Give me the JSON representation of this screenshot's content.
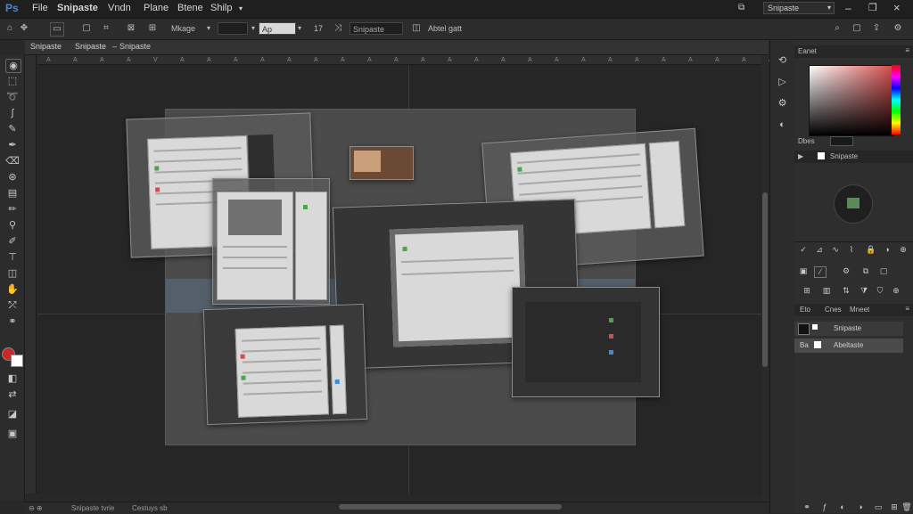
{
  "menu": {
    "logo": "Ps",
    "items": [
      "File",
      "Snipaste",
      "Vndn",
      "Plane",
      "Btene",
      "Shilp"
    ],
    "workspace_label": "Snipaste"
  },
  "options_bar": {
    "mode_label": "Mkage",
    "field_value": "Ap",
    "text_14": "17",
    "search_placeholder": "Snipaste",
    "action_label": "Abtel gatt"
  },
  "tabs": [
    {
      "label": "Snipaste"
    },
    {
      "label": "Snipaste"
    },
    {
      "label": "Snipaste"
    }
  ],
  "ruler_ticks": [
    "A",
    "A",
    "A",
    "A",
    "V",
    "A",
    "A",
    "A",
    "A",
    "A",
    "A",
    "A",
    "A",
    "A",
    "A",
    "A",
    "A",
    "A",
    "A",
    "A",
    "A",
    "A",
    "A",
    "A",
    "A",
    "A",
    "A",
    "A"
  ],
  "status": {
    "text": "Snipaste tvrie",
    "text2": "Cestuys sb"
  },
  "panels": {
    "color_tab": "Eanet",
    "swatch_label": "Dbes",
    "layer_tool_label": "Snipaste",
    "layers_tabs": [
      "Eto",
      "Cnes",
      "Mneet"
    ],
    "layers": [
      {
        "name": "Snipaste"
      },
      {
        "name": "Abeltaste"
      }
    ]
  },
  "colors": {
    "foreground": "#cc2626",
    "background": "#ffffff",
    "accent": "#3d8bd8"
  }
}
